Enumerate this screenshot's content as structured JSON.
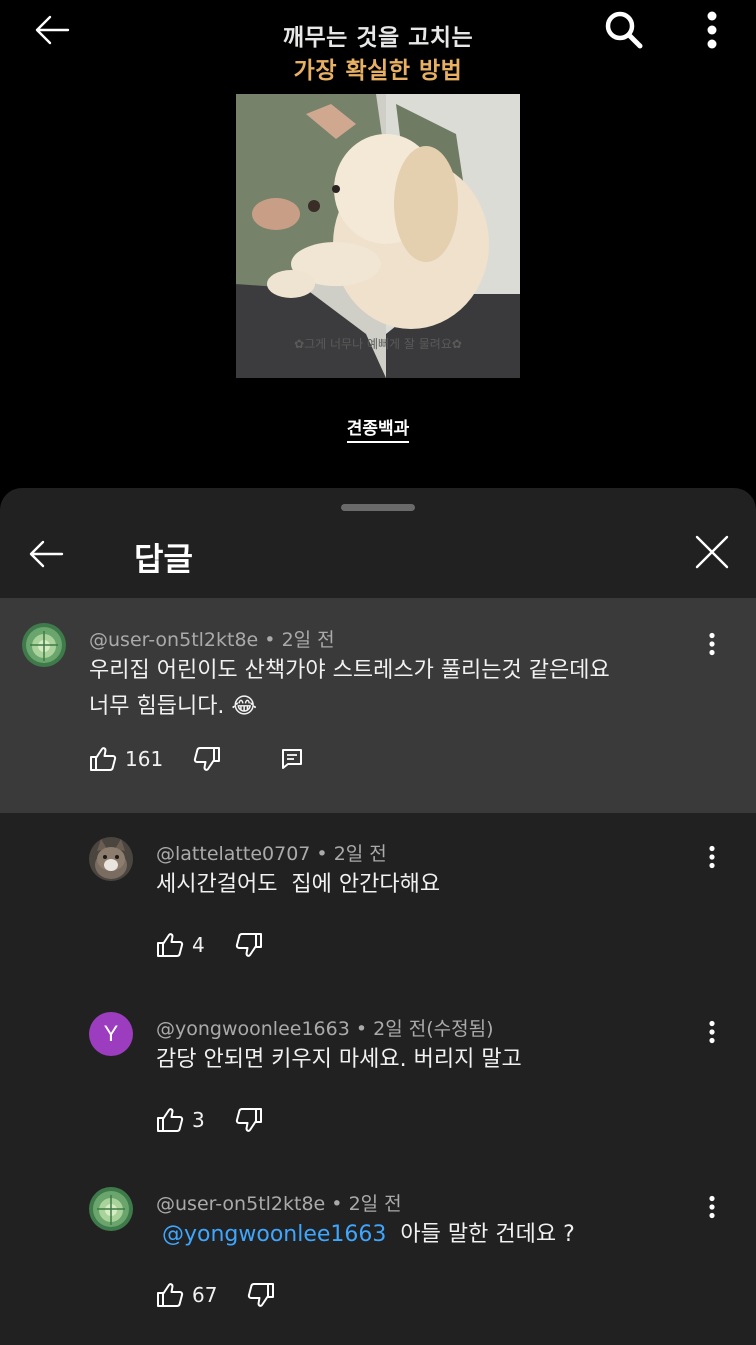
{
  "video": {
    "title_line1": "깨무는 것을 고치는",
    "title_line2": "가장 확실한 방법",
    "thumbnail_subtitle": "✿그게 너무나 예뻐게 잘 물려요✿",
    "channel_name": "견종백과",
    "icons": [
      "back-arrow-icon",
      "search-icon",
      "more-vert-icon"
    ]
  },
  "sheet": {
    "title": "답글",
    "icons": [
      "back-arrow-icon",
      "close-icon"
    ]
  },
  "comments": [
    {
      "author": "@user-on5tl2kt8e",
      "time": "2일 전",
      "line1": "우리집 어린이도 산책가야 스트레스가 풀리는것 같은데요",
      "line2": "너무 힘듭니다. 😂",
      "likes": "161",
      "avatar": "cabbage"
    },
    {
      "author": "@lattelatte0707",
      "time": "2일 전",
      "text": "세시간걸어도  집에 안간다해요",
      "likes": "4",
      "avatar": "cat"
    },
    {
      "author": "@yongwoonlee1663",
      "time": "2일 전(수정됨)",
      "text": "감당 안되면 키우지 마세요. 버리지 말고",
      "likes": "3",
      "avatar_letter": "Y",
      "avatar_color": "#9c3dbf"
    },
    {
      "author": "@user-on5tl2kt8e",
      "time": "2일 전",
      "mention": "@yongwoonlee1663",
      "text": "아들 말한 건데요 ?",
      "likes": "67",
      "avatar": "cabbage"
    }
  ],
  "separator": "•",
  "colors": {
    "background": "#000000",
    "sheet": "#212121",
    "highlight": "#3a3a3a",
    "title_accent": "#e7b063",
    "mention": "#3ea6ff"
  }
}
